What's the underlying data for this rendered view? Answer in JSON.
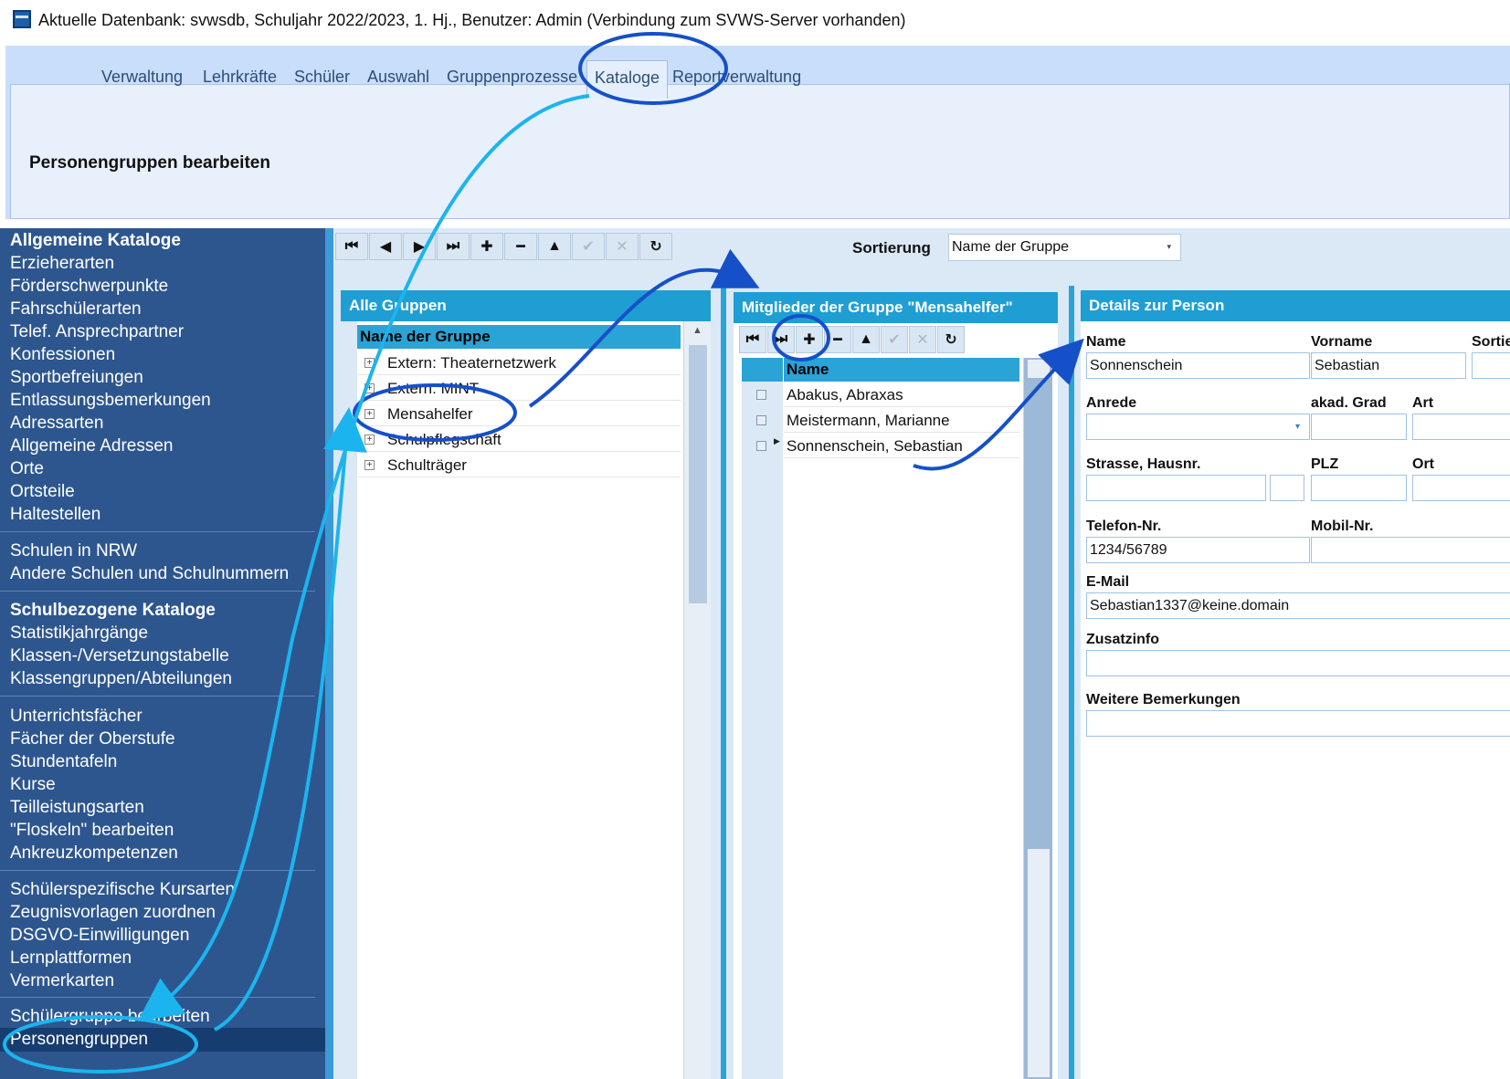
{
  "window": {
    "title": "Aktuelle Datenbank: svwsdb, Schuljahr 2022/2023, 1. Hj., Benutzer: Admin (Verbindung zum SVWS-Server vorhanden)"
  },
  "ribbon": {
    "tabs": [
      "Verwaltung",
      "Lehrkräfte",
      "Schüler",
      "Auswahl",
      "Gruppenprozesse",
      "Kataloge",
      "Reportverwaltung"
    ],
    "active_tab": "Kataloge",
    "panel_title": "Personengruppen bearbeiten"
  },
  "sidebar": {
    "groups": [
      {
        "header": "Allgemeine Kataloge",
        "items": [
          "Erzieherarten",
          "Förderschwerpunkte",
          "Fahrschülerarten",
          "Telef. Ansprechpartner",
          "Konfessionen",
          "Sportbefreiungen",
          "Entlassungsbemerkungen",
          "Adressarten",
          "Allgemeine Adressen",
          "Orte",
          "Ortsteile",
          "Haltestellen"
        ]
      },
      {
        "header": "",
        "items": [
          "Schulen in NRW",
          "Andere Schulen und Schulnummern"
        ]
      },
      {
        "header": "Schulbezogene Kataloge",
        "items": [
          "Statistikjahrgänge",
          "Klassen-/Versetzungstabelle",
          "Klassengruppen/Abteilungen"
        ]
      },
      {
        "header": "",
        "items": [
          "Unterrichtsfächer",
          "Fächer der Oberstufe",
          "Stundentafeln",
          "Kurse",
          "Teilleistungsarten",
          "\"Floskeln\" bearbeiten",
          "Ankreuzkompetenzen"
        ]
      },
      {
        "header": "",
        "items": [
          "Schülerspezifische Kursarten",
          "Zeugnisvorlagen zuordnen",
          "DSGVO-Einwilligungen",
          "Lernplattformen",
          "Vermerkarten"
        ]
      },
      {
        "header": "",
        "items": [
          "Schülergruppe bearbeiten",
          "Personengruppen"
        ]
      }
    ],
    "selected": "Personengruppen"
  },
  "sort": {
    "label": "Sortierung",
    "value": "Name der Gruppe"
  },
  "groups_pane": {
    "title": "Alle Gruppen",
    "column": "Name der Gruppe",
    "rows": [
      "Extern: Theaternetzwerk",
      "Extern: MINT",
      "Mensahelfer",
      "Schulpflegschaft",
      "Schulträger"
    ]
  },
  "members_pane": {
    "title": "Mitglieder der Gruppe \"Mensahelfer\"",
    "column": "Name",
    "rows": [
      "Abakus, Abraxas",
      "Meistermann, Marianne",
      "Sonnenschein, Sebastian"
    ]
  },
  "details": {
    "title": "Details zur Person",
    "name_label": "Name",
    "name": "Sonnenschein",
    "vorname_label": "Vorname",
    "vorname": "Sebastian",
    "sort_label": "Sortie",
    "anrede_label": "Anrede",
    "anrede": "",
    "grad_label": "akad. Grad",
    "art_label": "Art",
    "strasse_label": "Strasse, Hausnr.",
    "plz_label": "PLZ",
    "ort_label": "Ort",
    "telefon_label": "Telefon-Nr.",
    "telefon": "1234/56789",
    "mobil_label": "Mobil-Nr.",
    "email_label": "E-Mail",
    "email": "Sebastian1337@keine.domain",
    "zusatz_label": "Zusatzinfo",
    "bemerk_label": "Weitere Bemerkungen"
  },
  "colors": {
    "accent": "#1f9ed4",
    "sidebar": "#2d568f",
    "ribbon": "#c9defa",
    "annotation": "#1650c8",
    "annotation_light": "#1cb4ee"
  }
}
